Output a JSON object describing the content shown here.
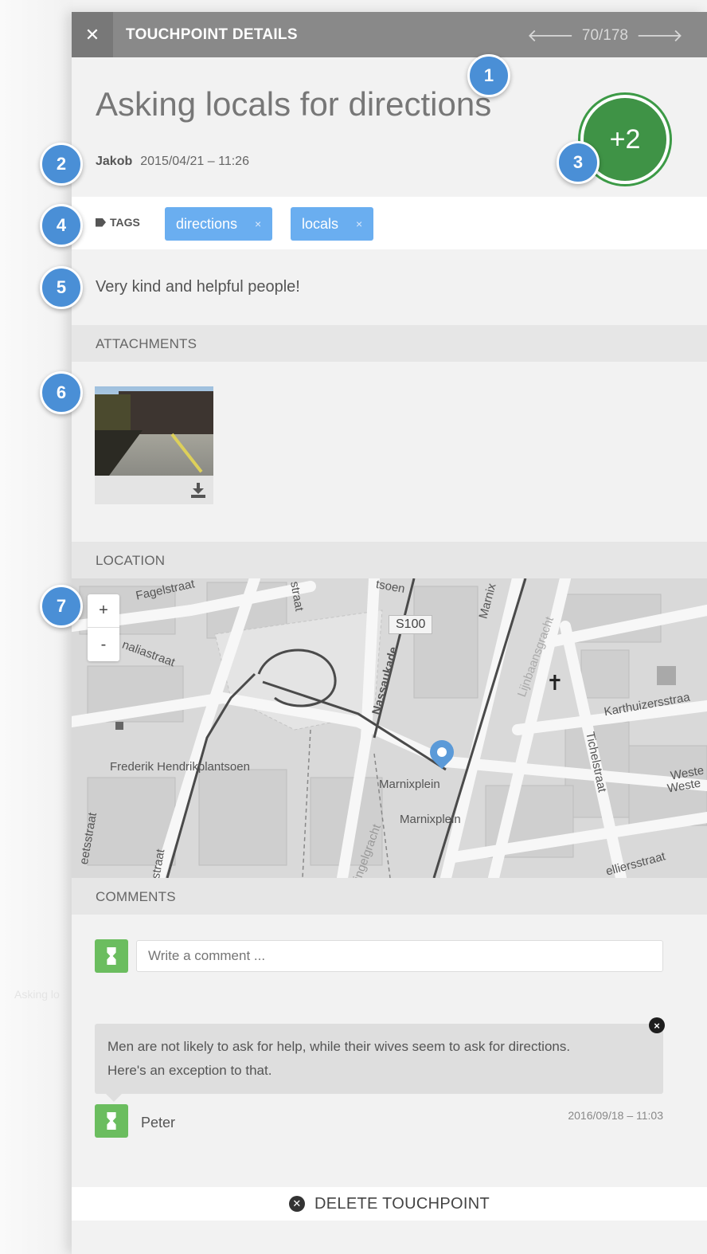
{
  "header": {
    "close_icon": "close-icon",
    "title": "TOUCHPOINT DETAILS",
    "prev_icon": "arrow-left-icon",
    "next_icon": "arrow-right-icon",
    "position": "70/178"
  },
  "touchpoint": {
    "title": "Asking locals for directions",
    "author": "Jakob",
    "datetime": "2015/04/21 – 11:26",
    "score": "+2",
    "description": "Very kind and helpful people!"
  },
  "tags": {
    "label": "TAGS",
    "items": [
      {
        "label": "directions",
        "remove": "×"
      },
      {
        "label": "locals",
        "remove": "×"
      }
    ]
  },
  "sections": {
    "attachments": "ATTACHMENTS",
    "location": "LOCATION",
    "comments": "COMMENTS"
  },
  "map": {
    "zoom_in": "+",
    "zoom_out": "-",
    "labels": {
      "fagelstraat": "Fagelstraat",
      "tsoen": "tsoen",
      "straat": "straat",
      "route": "S100",
      "marnix": "Marnix",
      "naliastraat": "naliastraat",
      "nassaukade": "Nassaukade",
      "lijnbaansgracht": "Lijnbaansgracht",
      "karthuizersstraat": "Karthuizersstraa",
      "frederik": "Frederik Hendrikplantsoen",
      "marnixplein1": "Marnixplein",
      "marnixplein2": "Marnixplein",
      "tichelstraat": "Tichelstraat",
      "weste1": "Weste",
      "weste2": "Weste",
      "singelgracht": "Singelgracht",
      "eetsstraat": "eetsstraat",
      "brstraat": "straat",
      "elliersstraat": "elliersstraat"
    }
  },
  "comments": {
    "placeholder": "Write a comment ...",
    "items": [
      {
        "text_line1": "Men are not likely to ask for help, while their wives seem to ask for directions.",
        "text_line2": "Here's an exception to that.",
        "author": "Peter",
        "datetime": "2016/09/18 – 11:03",
        "close": "×"
      }
    ]
  },
  "delete_label": "DELETE TOUCHPOINT",
  "callouts": [
    "1",
    "2",
    "3",
    "4",
    "5",
    "6",
    "7"
  ],
  "background_text": "Asking lo",
  "colors": {
    "header": "#898989",
    "tag": "#6aaef0",
    "score": "#3f9346",
    "callout": "#4a8fd6",
    "avatar": "#6bbd5f"
  }
}
